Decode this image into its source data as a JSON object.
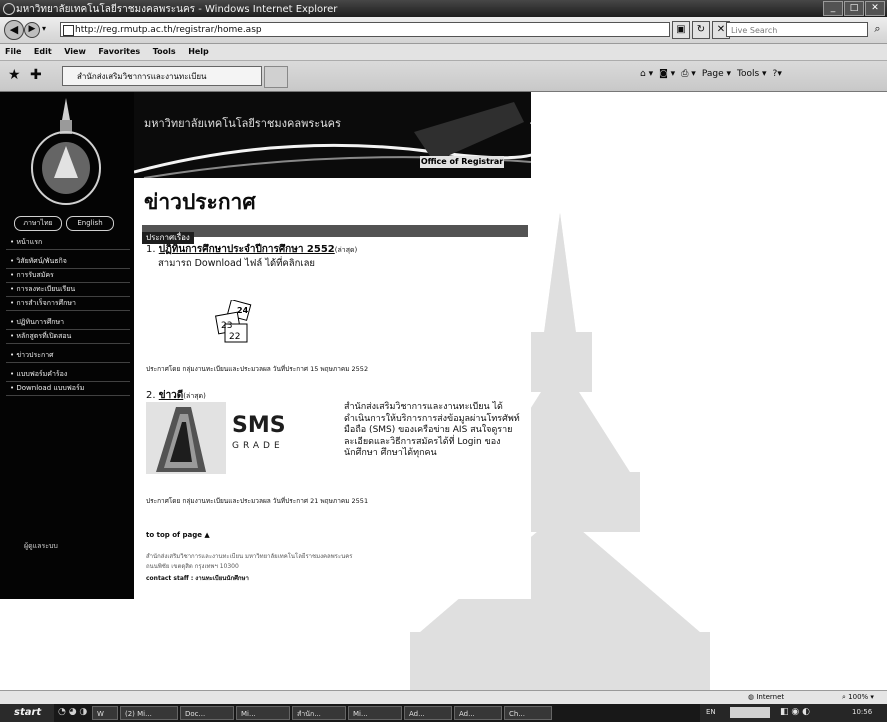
{
  "browser": {
    "window_title": "มหาวิทยาลัยเทคโนโลยีราชมงคลพระนคร - Windows Internet Explorer",
    "address": "http://reg.rmutp.ac.th/registrar/home.asp",
    "search_placeholder": "Live Search",
    "menu": [
      "File",
      "Edit",
      "View",
      "Favorites",
      "Tools",
      "Help"
    ],
    "tab_title": "สำนักส่งเสริมวิชาการและงานทะเบียน",
    "commands": [
      "Page ▾",
      "Tools ▾"
    ]
  },
  "site": {
    "banner_title": "มหาวิทยาลัยเทคโนโลยีราชมงคลพระนคร",
    "banner_dept": "Office of Registrar",
    "lang_buttons": [
      "ภาษาไทย",
      "English"
    ],
    "menu_group1": [
      "หน้าแรก",
      "วิสัยทัศน์/พันธกิจ",
      "การรับสมัคร",
      "การลงทะเบียนเรียน",
      "การสำเร็จการศึกษา"
    ],
    "menu_group2": [
      "ปฏิทินการศึกษา",
      "หลักสูตรที่เปิดสอน"
    ],
    "menu_group3": [
      "ข่าวประกาศ"
    ],
    "menu_group4": [
      "แบบฟอร์มคำร้อง",
      "Download แบบฟอร์ม"
    ],
    "sidebar_bottom": "ผู้ดูแลระบบ"
  },
  "content": {
    "heading": "ข่าวประกาศ",
    "section": "ประกาศเรื่อง",
    "news": [
      {
        "num": "1.",
        "title": "ปฏิทินการศึกษาประจำปีการศึกษา 2552",
        "tag": "(ล่าสุด)",
        "body": "สามารถ Download ไฟล์ ได้ที่คลิกเลย",
        "posted": "ประกาศโดย  กลุ่มงานทะเบียนและประมวลผล  วันที่ประกาศ  15 พฤษภาคม 2552"
      },
      {
        "num": "2.",
        "title": "ข่าวดี",
        "tag": "(ล่าสุด)",
        "body": "สำนักส่งเสริมวิชาการและงานทะเบียน ได้ดำเนินการให้บริการการส่งข้อมูลผ่านโทรศัพท์มือถือ (SMS) ของเครือข่าย AIS สนใจดูรายละเอียดและวิธีการสมัครได้ที่ Login ของนักศึกษา ศึกษาได้ทุกคน",
        "posted": "ประกาศโดย  กลุ่มงานทะเบียนและประมวลผล  วันที่ประกาศ  21 พฤษภาคม 2551"
      }
    ],
    "sms_big": "SMS",
    "sms_small": "GRADE",
    "cal_numbers": [
      "24",
      "23",
      "22"
    ]
  },
  "footer": {
    "to_top": "to top of page",
    "line1": "สำนักส่งเสริมวิชาการและงานทะเบียน  มหาวิทยาลัยเทคโนโลยีราชมงคลพระนคร",
    "line2": "ถนนพิชัย เขตดุสิต กรุงเทพฯ 10300",
    "contact": "contact staff : งานทะเบียนนักศึกษา"
  },
  "status": {
    "zone": "Internet",
    "zoom": "100%"
  },
  "taskbar": {
    "start": "start",
    "tasks": [
      "W",
      "(2) Mi...",
      "Doc...",
      "Mi...",
      "สำนัก...",
      "Mi...",
      "Ad...",
      "Ad...",
      "Ch..."
    ],
    "lang": "EN",
    "time": "10:56"
  }
}
